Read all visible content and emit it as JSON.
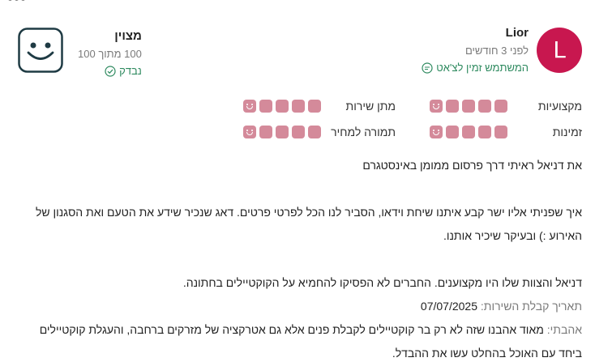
{
  "reviewer": {
    "avatar_letter": "L",
    "name": "Lior",
    "time_ago": "לפני 3 חודשים",
    "chat_label": "המשתמש זמין לצ'אט"
  },
  "overall": {
    "word": "מצוין",
    "score": "100 מתוך 100",
    "verified": "נבדק"
  },
  "categories": [
    {
      "label": "מקצועיות",
      "rating": 5
    },
    {
      "label": "מתן שירות",
      "rating": 5
    },
    {
      "label": "זמינות",
      "rating": 5
    },
    {
      "label": "תמורה למחיר",
      "rating": 5
    }
  ],
  "review": {
    "line1": "את דניאל ראיתי דרך פרסום ממומן באינסטגרם",
    "para2": "איך שפניתי אליו ישר קבע איתנו שיחת וידאו, הסביר לנו הכל לפרטי פרטים. דאג שנכיר שידע את הטעם ואת הסגנון של האירוע :) ובעיקר שיכיר אותנו.",
    "para3": "דניאל והצוות שלו היו מקצוענים. החברים לא הפסיקו להחמיא על הקוקטיילים בחתונה.",
    "service_date_label": "תאריך קבלת השירות:",
    "service_date_value": "07/07/2025",
    "loved_label": "אהבתי:",
    "loved_text": "מאוד אהבנו שזה לא רק בר קוקטיילים לקבלת פנים אלא גם אטרקציה של מזרקים ברחבה, והעגלת קוקטיילים ביחד עם האוכל בהחלט עשו את ההבדל."
  },
  "colors": {
    "avatar": "#c8174f",
    "rating_dot": "#d48a9a",
    "verified_green": "#2e8a5f"
  }
}
